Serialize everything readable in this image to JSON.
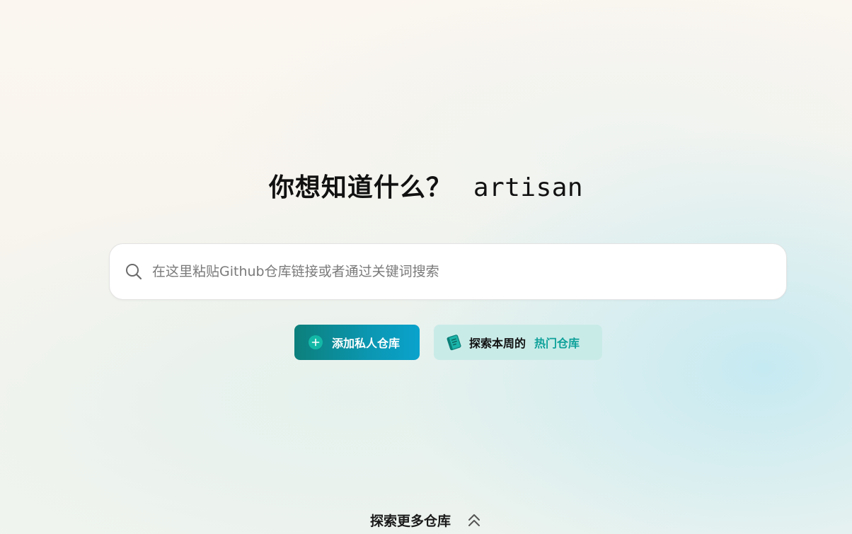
{
  "hero": {
    "question": "你想知道什么？",
    "keyword": "artisan"
  },
  "search": {
    "placeholder": "在这里粘贴Github仓库链接或者通过关键词搜索",
    "value": "",
    "icon": "search-icon"
  },
  "actions": {
    "add_private": {
      "label": "添加私人仓库",
      "icon": "plus-circle-icon"
    },
    "trending": {
      "label": "探索本周的",
      "highlight": "热门仓库",
      "icon": "book-icon"
    }
  },
  "footer": {
    "explore_more": "探索更多仓库",
    "icon": "double-chevron-up-icon"
  },
  "colors": {
    "accent_teal": "#0fa19a",
    "button_gradient_start": "#0c7f7b",
    "button_gradient_end": "#0aa2cc",
    "trending_bg": "#c9ebe8"
  }
}
